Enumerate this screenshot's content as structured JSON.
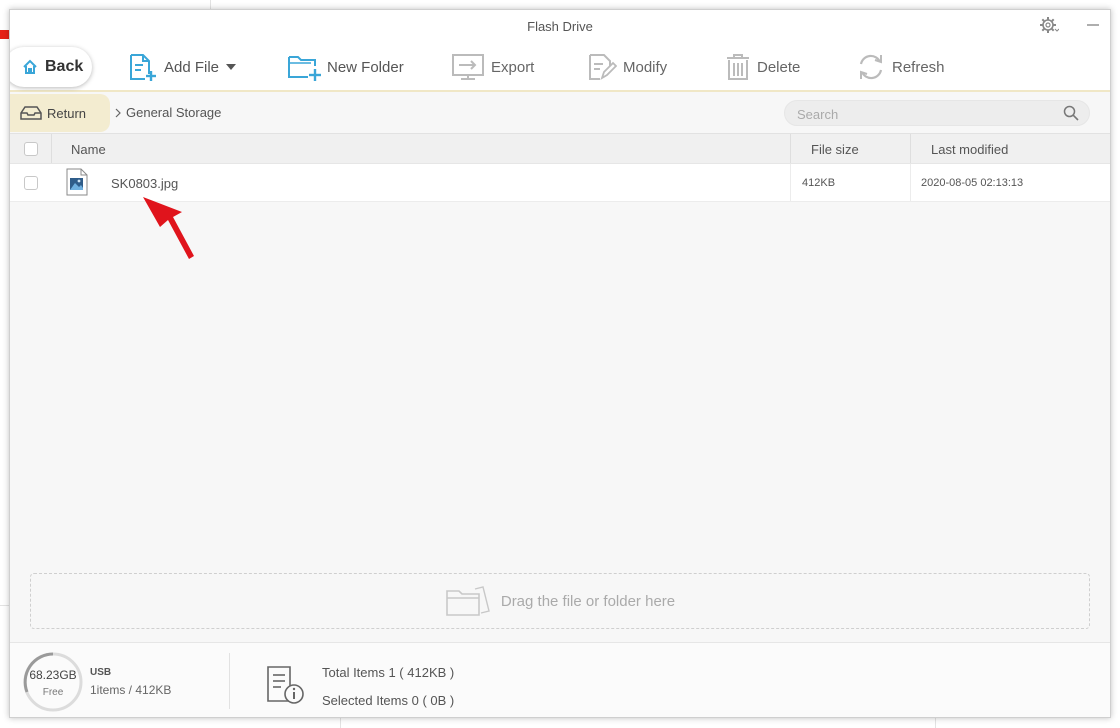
{
  "window": {
    "title": "Flash Drive"
  },
  "toolbar": {
    "back_label": "Back",
    "add_file_label": "Add File",
    "new_folder_label": "New Folder",
    "export_label": "Export",
    "modify_label": "Modify",
    "delete_label": "Delete",
    "refresh_label": "Refresh"
  },
  "pathbar": {
    "return_label": "Return",
    "breadcrumb": "General Storage",
    "search_placeholder": "Search"
  },
  "table": {
    "columns": {
      "name": "Name",
      "size": "File size",
      "modified": "Last modified"
    },
    "rows": [
      {
        "name": "SK0803.jpg",
        "size": "412KB",
        "modified": "2020-08-05 02:13:13"
      }
    ]
  },
  "drop_zone": {
    "label": "Drag the file or folder here"
  },
  "status": {
    "free_space": "68.23GB",
    "free_label": "Free",
    "device_name": "USB",
    "device_info": "1items / 412KB",
    "total_items": "Total Items 1 ( 412KB )",
    "selected_items": "Selected Items 0 ( 0B )"
  },
  "colors": {
    "accent_blue": "#3aa6d8",
    "return_bg": "#f3ecd0",
    "annotation_arrow": "#e0141c"
  },
  "icons": [
    "home-icon",
    "add-file-icon",
    "new-folder-icon",
    "export-icon",
    "modify-icon",
    "delete-icon",
    "refresh-icon",
    "settings-icon",
    "minimize-icon",
    "return-tray-icon",
    "search-icon",
    "image-file-icon",
    "folder-icon",
    "info-document-icon"
  ]
}
